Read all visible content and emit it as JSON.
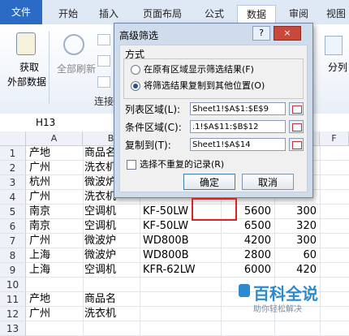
{
  "ribbon": {
    "tabs": [
      "文件",
      "开始",
      "插入",
      "页面布局",
      "公式",
      "数据",
      "审阅",
      "视图"
    ],
    "active_tab": "数据",
    "get_data_label_line1": "获取",
    "get_data_label_line2": "外部数据",
    "refresh_all_label": "全部刷新",
    "connections_label": "连接",
    "split_label": "分列"
  },
  "formula_bar": {
    "name_box": "H13"
  },
  "sheet": {
    "columns": [
      "A",
      "B",
      "F"
    ],
    "rows": [
      "1",
      "2",
      "3",
      "4",
      "5",
      "6",
      "7",
      "8",
      "9",
      "10",
      "11",
      "12",
      "13"
    ],
    "cells": [
      {
        "a": "产地",
        "b": "商品名",
        "c": "",
        "d": "",
        "e": ""
      },
      {
        "a": "广州",
        "b": "洗衣机",
        "c": "",
        "d": "",
        "e": ""
      },
      {
        "a": "杭州",
        "b": "微波炉",
        "c": "",
        "d": "",
        "e": ""
      },
      {
        "a": "广州",
        "b": "洗衣机",
        "c": "",
        "d": "",
        "e": ""
      },
      {
        "a": "南京",
        "b": "空调机",
        "c": "KF-50LW",
        "d": "5600",
        "e": "300"
      },
      {
        "a": "南京",
        "b": "空调机",
        "c": "KF-50LW",
        "d": "6500",
        "e": "320"
      },
      {
        "a": "广州",
        "b": "微波炉",
        "c": "WD800B",
        "d": "4200",
        "e": "300"
      },
      {
        "a": "上海",
        "b": "微波炉",
        "c": "WD800B",
        "d": "2800",
        "e": "60"
      },
      {
        "a": "上海",
        "b": "空调机",
        "c": "KFR-62LW",
        "d": "6000",
        "e": "420"
      },
      {
        "a": "",
        "b": "",
        "c": "",
        "d": "",
        "e": ""
      },
      {
        "a": "产地",
        "b": "商品名",
        "c": "",
        "d": "",
        "e": ""
      },
      {
        "a": "广州",
        "b": "洗衣机",
        "c": "",
        "d": "",
        "e": ""
      },
      {
        "a": "",
        "b": "",
        "c": "",
        "d": "",
        "e": ""
      }
    ]
  },
  "dialog": {
    "title": "高级筛选",
    "help": "?",
    "close": "×",
    "mode_group": "方式",
    "option_in_place": "在原有区域显示筛选结果(F)",
    "option_copy": "将筛选结果复制到其他位置(O)",
    "list_range_label": "列表区域(L):",
    "list_range_value": "Sheet1!$A$1:$E$9",
    "criteria_label": "条件区域(C):",
    "criteria_value": ".1!$A$11:$B$12",
    "copy_to_label": "复制到(T):",
    "copy_to_value": "Sheet1!$A$14",
    "unique_label": "选择不重复的记录(R)",
    "ok_label": "确定",
    "cancel_label": "取消"
  },
  "watermark": {
    "title": "百科全说",
    "subtitle": "助你轻松解决"
  }
}
